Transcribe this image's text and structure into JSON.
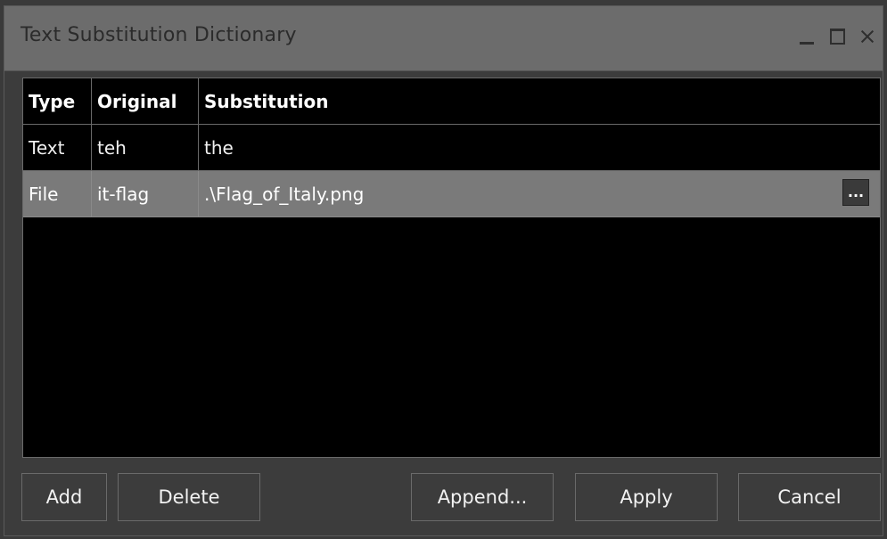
{
  "window": {
    "title": "Text Substitution Dictionary",
    "controls": {
      "minimize": "minimize-icon",
      "maximize": "maximize-icon",
      "close": "close-icon"
    }
  },
  "grid": {
    "columns": [
      "Type",
      "Original",
      "Substitution"
    ],
    "rows": [
      {
        "type": "Text",
        "original": "teh",
        "substitution": "the"
      },
      {
        "type": "File",
        "original": "it-flag",
        "substitution": ".\\Flag_of_Italy.png",
        "selected": true,
        "browse_label": "..."
      }
    ]
  },
  "buttons": {
    "add": "Add",
    "delete": "Delete",
    "append": "Append...",
    "apply": "Apply",
    "cancel": "Cancel"
  },
  "colors": {
    "titlebar": "#6c6c6c",
    "background": "#3c3c3c",
    "grid_background": "#000000",
    "selected_row": "#7a7a7a"
  }
}
